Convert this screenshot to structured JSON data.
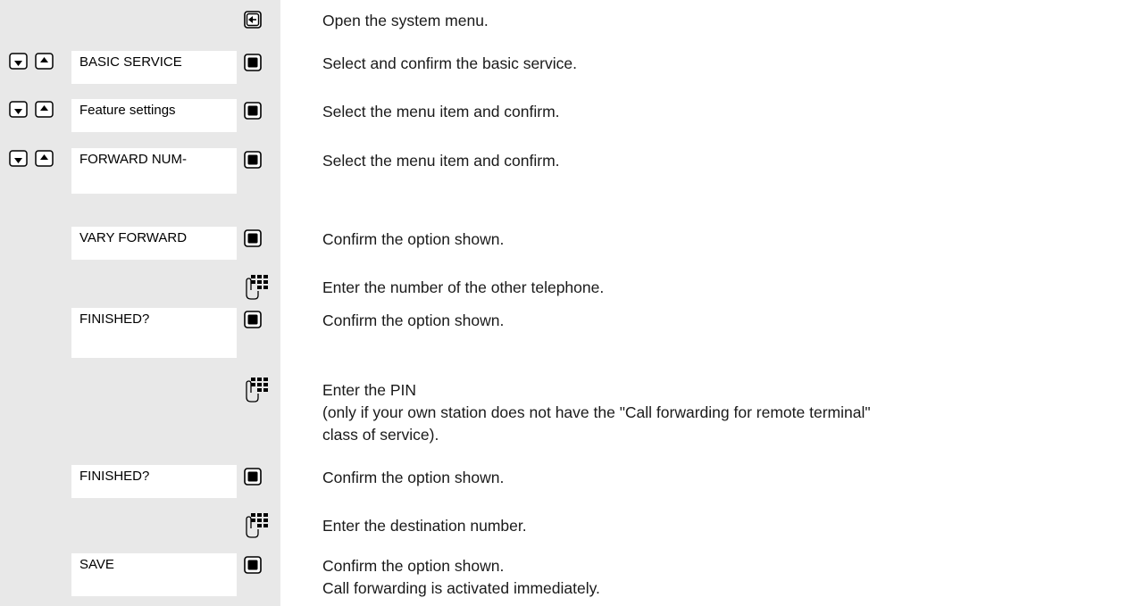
{
  "steps": [
    {
      "icon": "open-menu-icon",
      "label": null,
      "nav": false,
      "lines": [
        "Open the system menu."
      ]
    },
    {
      "icon": "ok-key-icon",
      "label": "BASIC SERVICE",
      "nav": true,
      "lines": [
        "Select and confirm the basic service."
      ]
    },
    {
      "icon": "ok-key-icon",
      "label": "Feature settings",
      "nav": true,
      "lines": [
        "Select the menu item and confirm."
      ]
    },
    {
      "icon": "ok-key-icon",
      "label": "FORWARD NUM-",
      "nav": true,
      "lines": [
        "Select the menu item and confirm."
      ]
    },
    {
      "icon": "ok-key-icon",
      "label": "VARY FORWARD",
      "nav": false,
      "lines": [
        "Confirm the option shown."
      ]
    },
    {
      "icon": "keypad-icon",
      "label": null,
      "nav": false,
      "lines": [
        "Enter the number of the other telephone."
      ]
    },
    {
      "icon": "ok-key-icon",
      "label": "FINISHED?",
      "nav": false,
      "lines": [
        "Confirm the option shown."
      ]
    },
    {
      "icon": "keypad-icon",
      "label": null,
      "nav": false,
      "lines": [
        "Enter the PIN",
        "(only if your own station does not have the \"Call forwarding for remote terminal\"",
        "class of service)."
      ]
    },
    {
      "icon": "ok-key-icon",
      "label": "FINISHED?",
      "nav": false,
      "lines": [
        "Confirm the option shown."
      ]
    },
    {
      "icon": "keypad-icon",
      "label": null,
      "nav": false,
      "lines": [
        "Enter the destination number."
      ]
    },
    {
      "icon": "ok-key-icon",
      "label": "SAVE",
      "nav": false,
      "lines": [
        "Confirm the option shown.",
        "Call forwarding is activated immediately."
      ]
    }
  ]
}
